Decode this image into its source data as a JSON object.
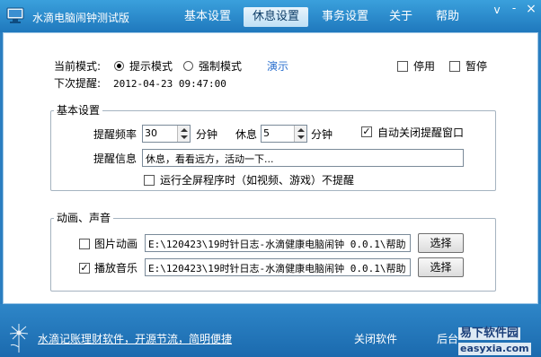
{
  "window": {
    "title": "水滴电脑闹钟测试版",
    "controls": {
      "menu": "v",
      "minimize": "-",
      "close": "×"
    }
  },
  "tabs": [
    {
      "label": "基本设置",
      "active": false
    },
    {
      "label": "休息设置",
      "active": true
    },
    {
      "label": "事务设置",
      "active": false
    },
    {
      "label": "关于",
      "active": false
    },
    {
      "label": "帮助",
      "active": false
    }
  ],
  "mode": {
    "label": "当前模式:",
    "options": [
      "提示模式",
      "强制模式"
    ],
    "selected": "提示模式",
    "demo_link": "演示",
    "stop_label": "停用",
    "pause_label": "暂停",
    "next_label": "下次提醒:",
    "next_time": "2012-04-23 09:47:00"
  },
  "basic": {
    "legend": "基本设置",
    "freq_label": "提醒频率",
    "freq_value": "30",
    "freq_unit": "分钟",
    "rest_label": "休息",
    "rest_value": "5",
    "rest_unit": "分钟",
    "auto_close_label": "自动关闭提醒窗口",
    "auto_close_checked": true,
    "message_label": "提醒信息",
    "message_value": "休息，看看远方，活动一下...",
    "fullscreen_label": "运行全屏程序时（如视频、游戏）不提醒",
    "fullscreen_checked": false
  },
  "media": {
    "legend": "动画、声音",
    "animation_label": "图片动画",
    "animation_checked": false,
    "animation_path": "E:\\120423\\19时针日志-水滴健康电脑闹钟 0.0.1\\帮助",
    "music_label": "播放音乐",
    "music_checked": true,
    "music_path": "E:\\120423\\19时针日志-水滴健康电脑闹钟 0.0.1\\帮助",
    "choose_label": "选择"
  },
  "footer": {
    "link": "水滴记账理财软件，开源节流，简明便捷",
    "close_software": "关闭软件",
    "background": "后台",
    "watermark_top": "易下软件园",
    "watermark_bottom": "easyxia.com"
  },
  "colors": {
    "title_bar": "#2a8ed0",
    "active_tab": "#d8ecf8",
    "link": "#2a6fcf",
    "footer": "#2276bb"
  }
}
